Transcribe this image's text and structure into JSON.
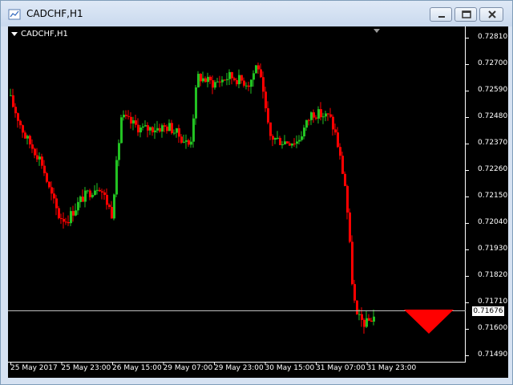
{
  "window": {
    "title": "CADCHF,H1",
    "icon": "chart-window-icon",
    "buttons": [
      "minimize-icon",
      "maximize-icon",
      "close-icon"
    ]
  },
  "chart": {
    "symbol_label": "CADCHF,H1",
    "current_price": "0.71676",
    "price_axis": [
      "0.72810",
      "0.72700",
      "0.72590",
      "0.72480",
      "0.72370",
      "0.72260",
      "0.72150",
      "0.72040",
      "0.71930",
      "0.71820",
      "0.71710",
      "0.71600",
      "0.71490"
    ],
    "time_axis": [
      "25 May 2017",
      "25 May 23:00",
      "26 May 15:00",
      "29 May 07:00",
      "29 May 23:00",
      "30 May 15:00",
      "31 May 07:00",
      "31 May 23:00"
    ],
    "colors": {
      "background": "#000000",
      "bull": "#22c222",
      "bear": "#ff0000",
      "axis": "#ffffff",
      "grid_line": "#c0c0c0",
      "arrow": "#ff0000"
    },
    "signal_arrow": "down-arrow"
  }
}
